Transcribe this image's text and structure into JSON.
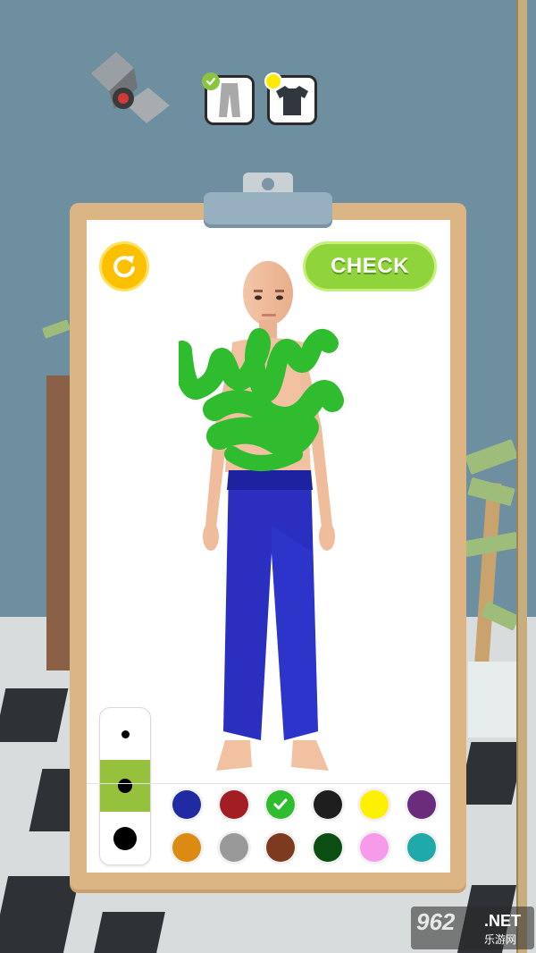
{
  "game": {
    "clothing_tray": [
      {
        "id": "pants",
        "icon": "pants-icon",
        "status": "completed"
      },
      {
        "id": "shirt",
        "icon": "tshirt-icon",
        "status": "active"
      }
    ],
    "check_label": "CHECK",
    "reset_icon": "reset-icon",
    "brush_sizes": [
      "small",
      "medium",
      "large"
    ],
    "selected_brush": "medium",
    "palette": [
      {
        "name": "navy-blue",
        "color": "#1f2aa3"
      },
      {
        "name": "red",
        "color": "#a31e24"
      },
      {
        "name": "green",
        "color": "#2fbd2f",
        "selected": true
      },
      {
        "name": "black",
        "color": "#1e1e1e"
      },
      {
        "name": "yellow",
        "color": "#ffef00"
      },
      {
        "name": "purple",
        "color": "#6b2c7c"
      },
      {
        "name": "orange",
        "color": "#dd8a12"
      },
      {
        "name": "gray",
        "color": "#999999"
      },
      {
        "name": "brown",
        "color": "#7d3a1e"
      },
      {
        "name": "dark-green",
        "color": "#0a4e12"
      },
      {
        "name": "pink",
        "color": "#f79ae9"
      },
      {
        "name": "teal",
        "color": "#1faaa9"
      }
    ],
    "paint_color": "#2fbd2f",
    "pants_color": "#2a2fc0"
  },
  "watermark": {
    "number": "962",
    "suffix": ".NET",
    "cn": "乐游网"
  }
}
